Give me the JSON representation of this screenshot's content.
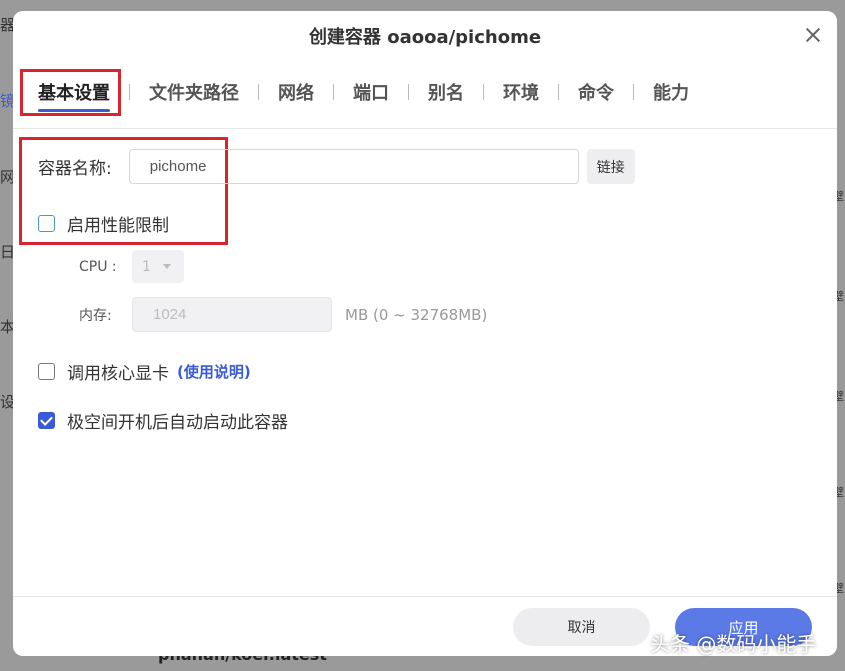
{
  "background": {
    "left_fragments": [
      "器",
      "镜",
      "网",
      "日",
      "本",
      "设"
    ],
    "right_fragments": [
      "壁",
      "壁",
      "壁",
      "壁",
      "壁"
    ],
    "bottom_text": "phanan/koel:latest"
  },
  "dialog": {
    "title": "创建容器 oaooa/pichome",
    "tabs": [
      "基本设置",
      "文件夹路径",
      "网络",
      "端口",
      "别名",
      "环境",
      "命令",
      "能力"
    ],
    "active_tab": 0,
    "container_name": {
      "label": "容器名称:",
      "value": "pichome",
      "link_button": "链接"
    },
    "perf_limit": {
      "label": "启用性能限制",
      "checked": false
    },
    "cpu": {
      "label": "CPU :",
      "value": "1"
    },
    "memory": {
      "label": "内存:",
      "value": "1024",
      "range": "MB (0 ~ 32768MB)"
    },
    "gpu": {
      "label": "调用核心显卡",
      "help_link": "(使用说明)",
      "checked": false
    },
    "autostart": {
      "label": "极空间开机后自动启动此容器",
      "checked": true
    },
    "footer": {
      "cancel": "取消",
      "apply": "应用"
    }
  },
  "watermark": "头条 @数码小能手",
  "colors": {
    "accent": "#3b5bd6",
    "highlight": "#d9262e",
    "apply": "#5b7ae6"
  }
}
